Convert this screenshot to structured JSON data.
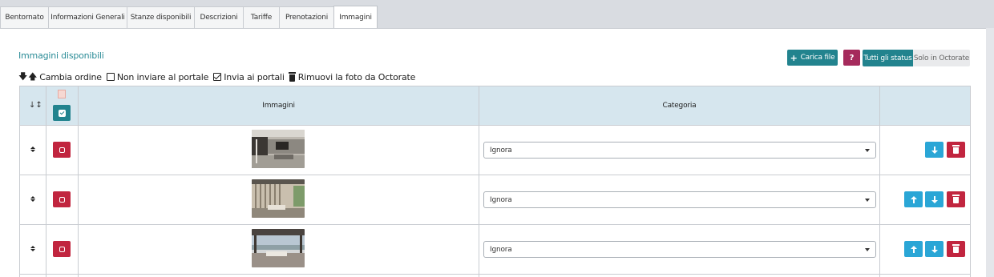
{
  "tabs": [
    {
      "label": "Bentornato",
      "active": false
    },
    {
      "label": "Informazioni Generali",
      "active": false
    },
    {
      "label": "Stanze disponibili",
      "active": false
    },
    {
      "label": "Descrizioni",
      "active": false
    },
    {
      "label": "Tariffe",
      "active": false
    },
    {
      "label": "Prenotazioni",
      "active": false
    },
    {
      "label": "Immagini",
      "active": true
    }
  ],
  "section": {
    "title": "Immagini disponibili"
  },
  "actions": {
    "upload_label": "Carica file",
    "help_label": "?",
    "filter_all_label": "Tutti gli status",
    "filter_octorate_label": "Solo in Octorate"
  },
  "toolbar": {
    "reorder_label": "Cambia ordine",
    "no_send_label": "Non inviare al portale",
    "send_label": "Invia ai portali",
    "remove_label": "Rimuovi la foto da Octorate"
  },
  "table": {
    "headers": {
      "images": "Immagini",
      "category": "Categoria"
    },
    "rows": [
      {
        "category": "Ignora",
        "can_move_up": false,
        "can_move_down": true
      },
      {
        "category": "Ignora",
        "can_move_up": true,
        "can_move_down": true
      },
      {
        "category": "Ignora",
        "can_move_up": true,
        "can_move_down": true
      }
    ]
  },
  "colors": {
    "accent": "#22838e",
    "danger": "#c1253f",
    "info": "#2aa6d6",
    "help": "#a52a5c",
    "header_bg": "#d6e6ee"
  },
  "icons": [
    "arrow-down-icon",
    "arrow-up-icon",
    "checkbox-icon",
    "checkbox-checked-icon",
    "trash-icon",
    "plus-icon",
    "sort-icon",
    "move-handle-icon",
    "chevron-down-icon",
    "image-placeholder-icon"
  ]
}
